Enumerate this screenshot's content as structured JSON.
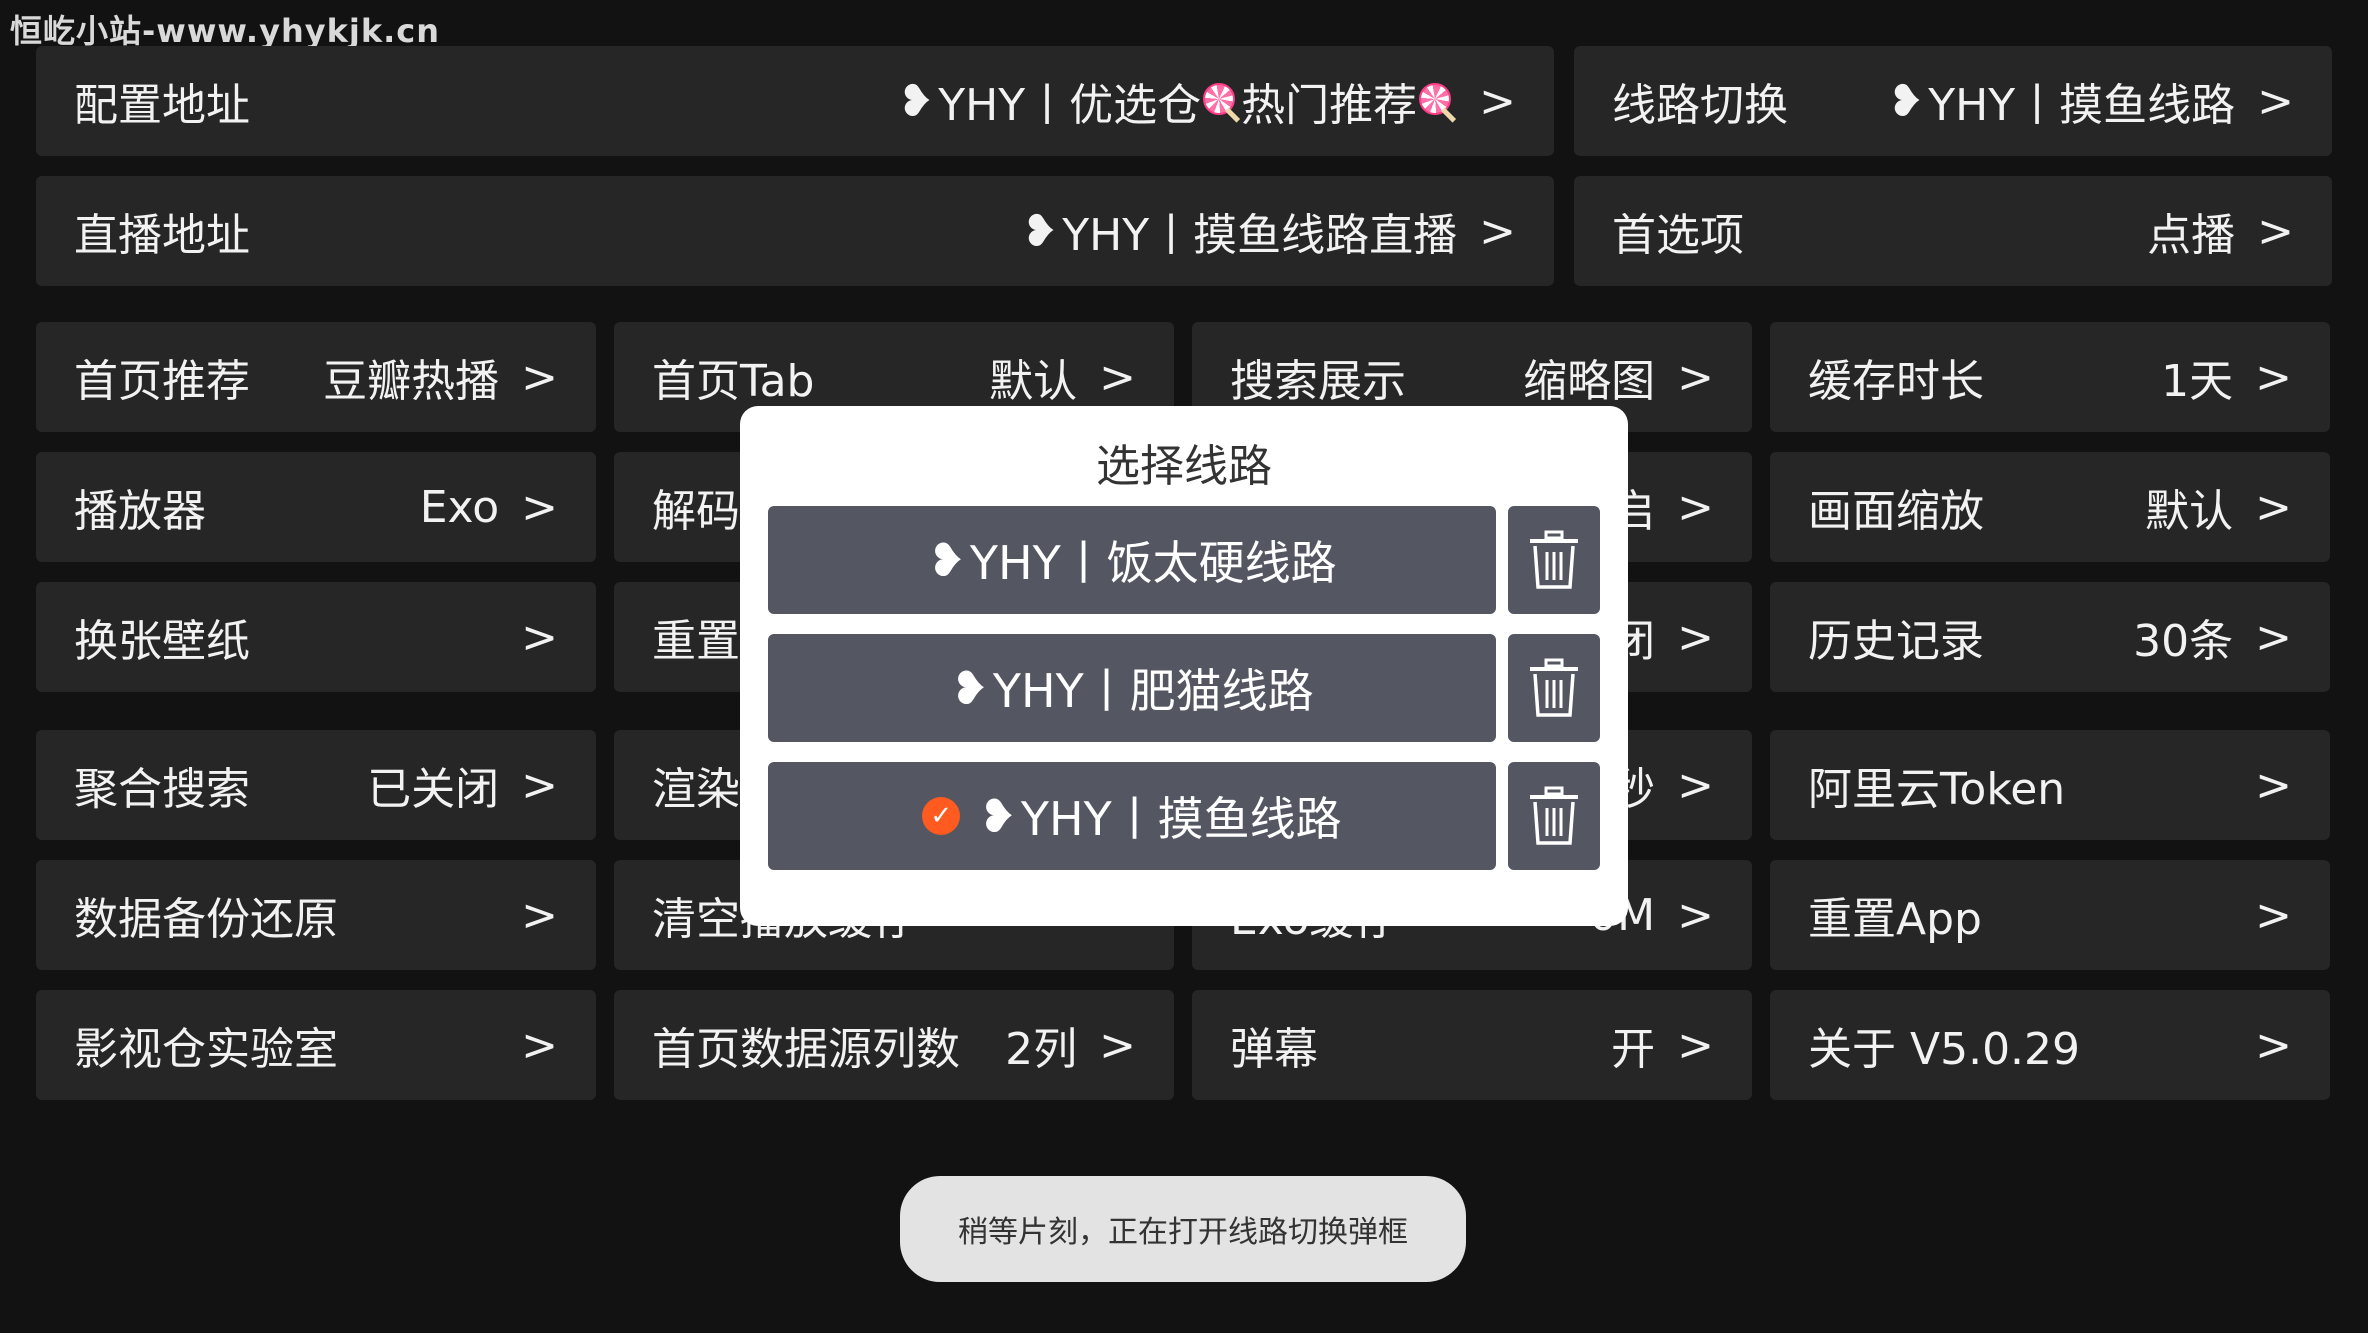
{
  "watermark": "恒屹小站-www.yhykjk.cn",
  "config": {
    "label": "配置地址",
    "value": "YHY丨优选仓",
    "value2": "热门推荐",
    "arrow": ">"
  },
  "route_switch": {
    "label": "线路切换",
    "value": "YHY丨摸鱼线路",
    "arrow": ">"
  },
  "live": {
    "label": "直播地址",
    "value": "YHY丨摸鱼线路直播",
    "arrow": ">"
  },
  "preference": {
    "label": "首选项",
    "value": "点播",
    "arrow": ">"
  },
  "settings": [
    {
      "label": "首页推荐",
      "value": "豆瓣热播",
      "arrow": ">"
    },
    {
      "label": "首页Tab",
      "value": "默认",
      "arrow": ">"
    },
    {
      "label": "搜索展示",
      "value": "缩略图",
      "arrow": ">"
    },
    {
      "label": "缓存时长",
      "value": "1天",
      "arrow": ">"
    },
    {
      "label": "播放器",
      "value": "Exo",
      "arrow": ">"
    },
    {
      "label": "解码",
      "value": "",
      "arrow": ""
    },
    {
      "label": "",
      "value": "启",
      "arrow": ">"
    },
    {
      "label": "画面缩放",
      "value": "默认",
      "arrow": ">"
    },
    {
      "label": "换张壁纸",
      "value": "",
      "arrow": ">"
    },
    {
      "label": "重置",
      "value": "",
      "arrow": ""
    },
    {
      "label": "",
      "value": "闭",
      "arrow": ">"
    },
    {
      "label": "历史记录",
      "value": "30条",
      "arrow": ">"
    },
    {
      "label": "聚合搜索",
      "value": "已关闭",
      "arrow": ">"
    },
    {
      "label": "渲染",
      "value": "",
      "arrow": ""
    },
    {
      "label": "",
      "value": "秒",
      "arrow": ">"
    },
    {
      "label": "阿里云Token",
      "value": "",
      "arrow": ">"
    },
    {
      "label": "数据备份还原",
      "value": "",
      "arrow": ">"
    },
    {
      "label": "清空播放缓存",
      "value": "",
      "arrow": ""
    },
    {
      "label": "Exo缓存",
      "value": "0M",
      "arrow": ">"
    },
    {
      "label": "重置App",
      "value": "",
      "arrow": ">"
    },
    {
      "label": "影视仓实验室",
      "value": "",
      "arrow": ">"
    },
    {
      "label": "首页数据源列数",
      "value": "2列",
      "arrow": ">"
    },
    {
      "label": "弹幕",
      "value": "开",
      "arrow": ">"
    },
    {
      "label": "关于 V5.0.29",
      "value": "",
      "arrow": ">"
    }
  ],
  "dialog": {
    "title": "选择线路",
    "routes": [
      {
        "label": "YHY丨饭太硬线路",
        "selected": false
      },
      {
        "label": "YHY丨肥猫线路",
        "selected": false
      },
      {
        "label": "YHY丨摸鱼线路",
        "selected": true
      }
    ],
    "delete_icon": "trash-icon"
  },
  "toast": "稍等片刻，正在打开线路切换弹框",
  "colors": {
    "background": "#121212",
    "tile": "#262626",
    "route_button": "#545661",
    "check": "#ff5a1f"
  }
}
